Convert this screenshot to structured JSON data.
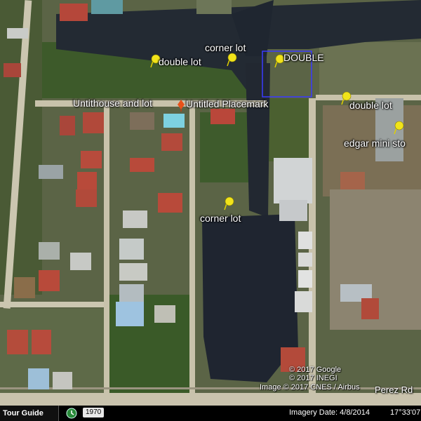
{
  "map": {
    "placemarks": [
      {
        "id": "double-lot-1",
        "label": "double lot",
        "color": "yellow"
      },
      {
        "id": "corner-lot-1",
        "label": "corner lot",
        "color": "yellow"
      },
      {
        "id": "double",
        "label": "DOUBLE",
        "color": "yellow"
      },
      {
        "id": "double-lot-2",
        "label": "double lot",
        "color": "yellow"
      },
      {
        "id": "edgar",
        "label": "edgar mini sto",
        "color": "yellow"
      },
      {
        "id": "untithouse",
        "label": "Untithouse and lot",
        "color": "none"
      },
      {
        "id": "untitled",
        "label": "Untitled Placemark",
        "color": "red"
      },
      {
        "id": "corner-lot-2",
        "label": "corner lot",
        "color": "yellow"
      }
    ],
    "road_label": "Perez Rd",
    "attribution": [
      "© 2017 Google",
      "© 2017 INEGI",
      "Image © 2017 CNES / Airbus"
    ]
  },
  "statusbar": {
    "tour_guide": "Tour Guide",
    "year": "1970",
    "imagery_date": "Imagery Date: 4/8/2014",
    "coordinates": "17°33'07"
  },
  "colors": {
    "water": "#1e2430",
    "vegetation": "#3f5a2c",
    "road": "#c9c3ad",
    "roof_red": "#b14a3a",
    "polygon": "#3a3aff",
    "pin_yellow": "#f1e31a",
    "pin_red": "#e8521a"
  }
}
